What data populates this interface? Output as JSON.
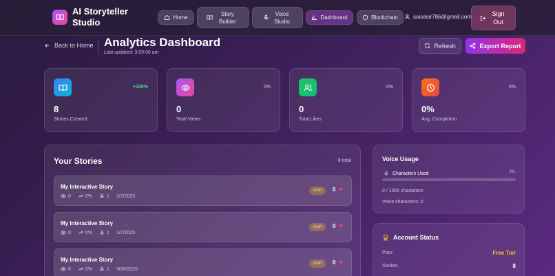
{
  "brand": {
    "title": "AI Storyteller Studio"
  },
  "nav": {
    "home": "Home",
    "story_builder": "Story Builder",
    "voice_studio": "Voice Studio",
    "dashboard": "Dashboard",
    "blockchain": "Blockchain",
    "user_email": "saisasir786@gmail.com",
    "sign_out": "Sign Out"
  },
  "header": {
    "back": "Back to Home",
    "title": "Analytics Dashboard",
    "last_updated": "Last updated: 3:09:06 am",
    "refresh": "Refresh",
    "export": "Export Report"
  },
  "stats": [
    {
      "value": "8",
      "label": "Stories Created",
      "change": "+100%",
      "color": "#3b82f6",
      "icon": "book-icon"
    },
    {
      "value": "0",
      "label": "Total Views",
      "change": "0%",
      "color": "#c026d3",
      "icon": "eye-icon"
    },
    {
      "value": "0",
      "label": "Total Likes",
      "change": "0%",
      "color": "#10b981",
      "icon": "users-icon"
    },
    {
      "value": "0%",
      "label": "Avg. Completion",
      "change": "0%",
      "color": "#f97316",
      "icon": "clock-icon"
    }
  ],
  "stories": {
    "title": "Your Stories",
    "total": "8 total",
    "items": [
      {
        "title": "My Interactive Story",
        "views": "0",
        "completion": "0%",
        "voices": "1",
        "date": "1/7/2025",
        "status": "draft",
        "likes": "0"
      },
      {
        "title": "My Interactive Story",
        "views": "0",
        "completion": "0%",
        "voices": "1",
        "date": "1/7/2025",
        "status": "draft",
        "likes": "0"
      },
      {
        "title": "My Interactive Story",
        "views": "0",
        "completion": "0%",
        "voices": "1",
        "date": "30/6/2025",
        "status": "draft",
        "likes": "0"
      }
    ]
  },
  "voice_usage": {
    "title": "Voice Usage",
    "characters_label": "Characters Used",
    "percent": "0%",
    "usage_fraction": 0,
    "characters_text": "0 / 1000 characters",
    "voice_characters": "Voice characters: 0"
  },
  "account": {
    "title": "Account Status",
    "plan_label": "Plan:",
    "plan_value": "Free Tier",
    "stories_label": "Stories:",
    "stories_value": "8"
  }
}
